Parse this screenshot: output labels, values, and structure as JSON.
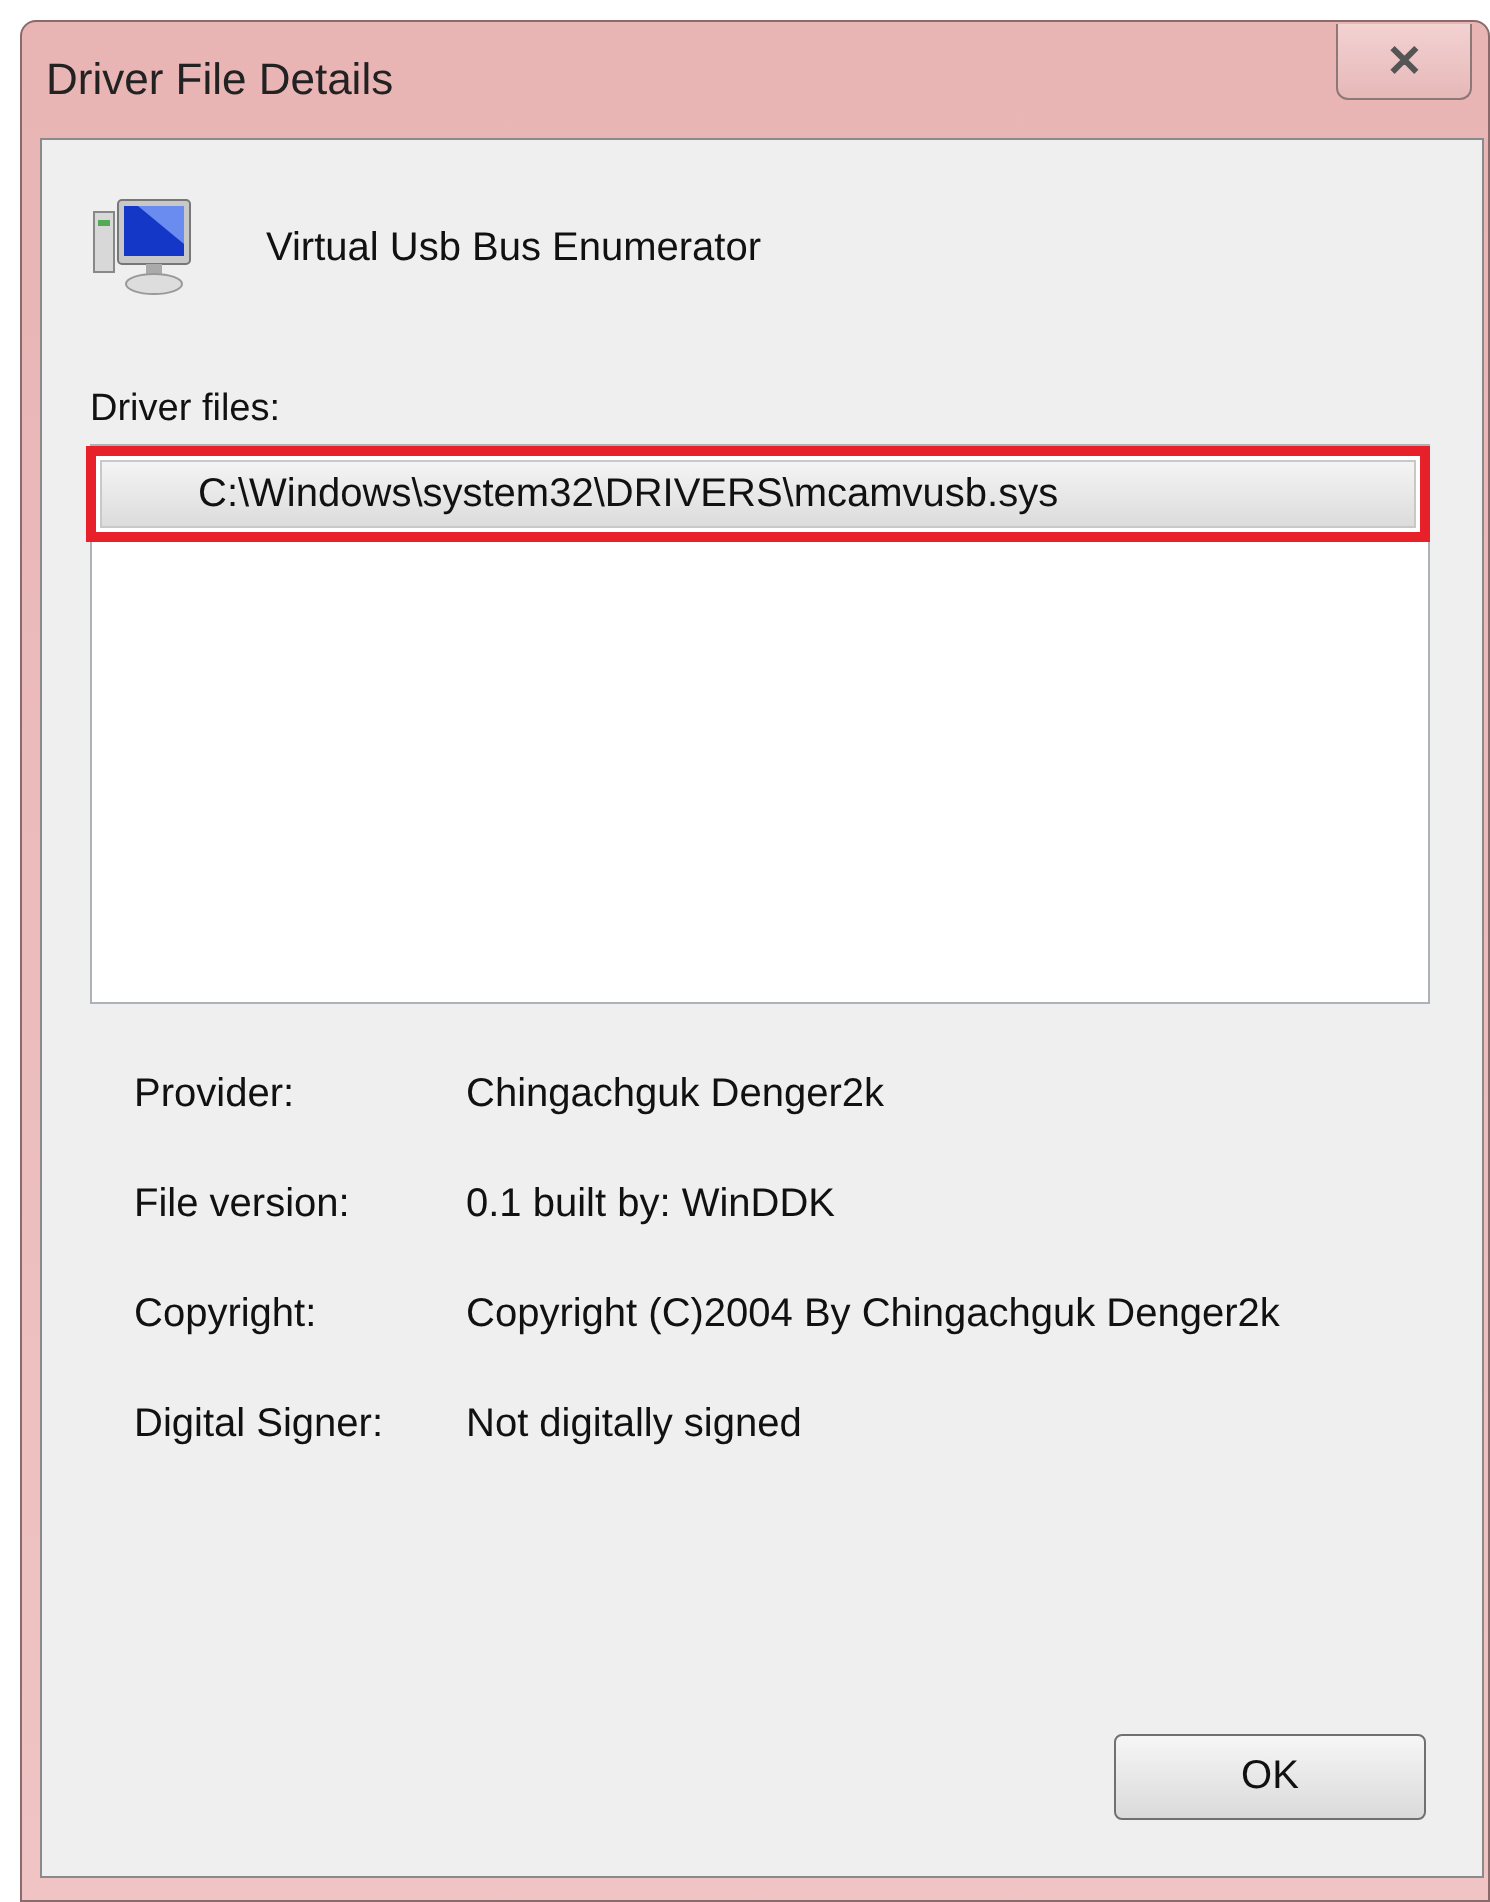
{
  "window": {
    "title": "Driver File Details",
    "close_button": "✕"
  },
  "device": {
    "name": "Virtual Usb Bus Enumerator"
  },
  "driver_files": {
    "label": "Driver files:",
    "items": [
      {
        "path": "C:\\Windows\\system32\\DRIVERS\\mcamvusb.sys",
        "selected": true,
        "highlighted": true
      }
    ]
  },
  "details": [
    {
      "label": "Provider:",
      "value": "Chingachguk  Denger2k"
    },
    {
      "label": "File version:",
      "value": "0.1 built by: WinDDK"
    },
    {
      "label": "Copyright:",
      "value": "Copyright (C)2004 By Chingachguk  Denger2k"
    },
    {
      "label": "Digital Signer:",
      "value": "Not digitally signed"
    }
  ],
  "buttons": [
    {
      "label": "OK"
    }
  ]
}
